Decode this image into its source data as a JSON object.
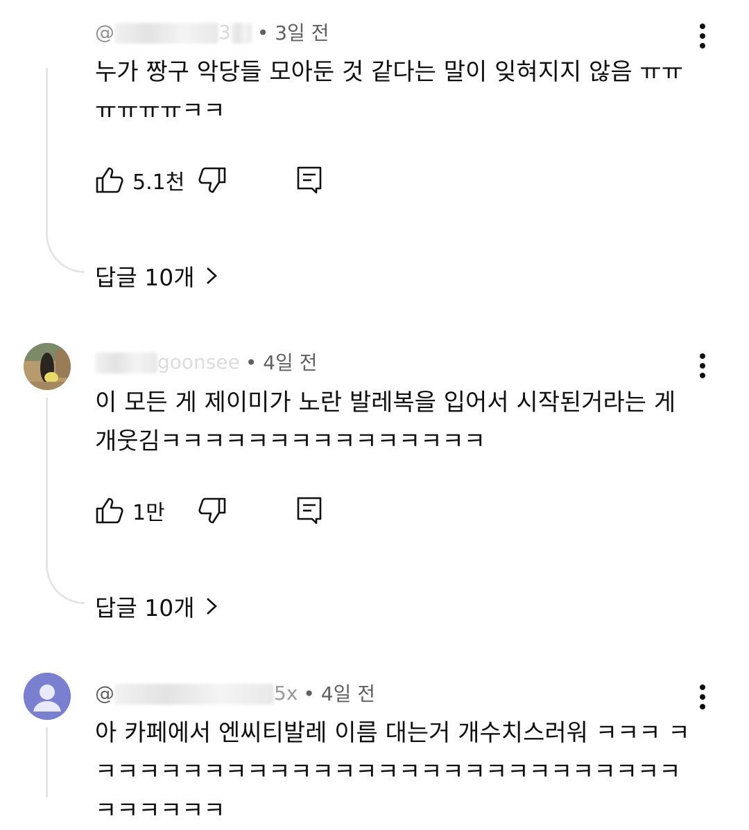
{
  "comments": [
    {
      "handle_visible": "@",
      "handle_tail": "3",
      "time": "• 3일 전",
      "text": "누가 짱구 악당들 모아둔 것 같다는 말이 잊혀지지 않음 ㅠㅠㅠㅠㅠㅠㅋㅋ",
      "likes": "5.1천",
      "replies": "답글 10개",
      "avatar": "none"
    },
    {
      "handle_visible": "",
      "handle_tail": "goonsee",
      "time": "• 4일 전",
      "text": "이 모든 게 제이미가 노란 발레복을 입어서 시작된거라는 게 개웃김ㅋㅋㅋㅋㅋㅋㅋㅋㅋㅋㅋㅋㅋㅋㅋ",
      "likes": "1만",
      "replies": "답글 10개",
      "avatar": "photo"
    },
    {
      "handle_visible": "@",
      "handle_tail": "5x",
      "time": "• 4일 전",
      "text": "아 카페에서 엔씨티발레 이름 대는거 개수치스러워 ㅋㅋㅋ ㅋㅋㅋㅋㅋㅋㅋㅋㅋㅋㅋㅋㅋㅋㅋㅋㅋㅋㅋㅋㅋㅋㅋㅋㅋㅋㅋㅋㅋㅋㅋㅋㅋㅋ",
      "avatar": "default"
    }
  ],
  "colors": {
    "text": "#0f0f0f",
    "meta": "#606060",
    "thread_line": "#e5e5e5",
    "default_avatar": "#7b7fd0"
  },
  "icons": [
    "like-icon",
    "dislike-icon",
    "reply-icon",
    "more-options-icon",
    "chevron-right-icon"
  ]
}
